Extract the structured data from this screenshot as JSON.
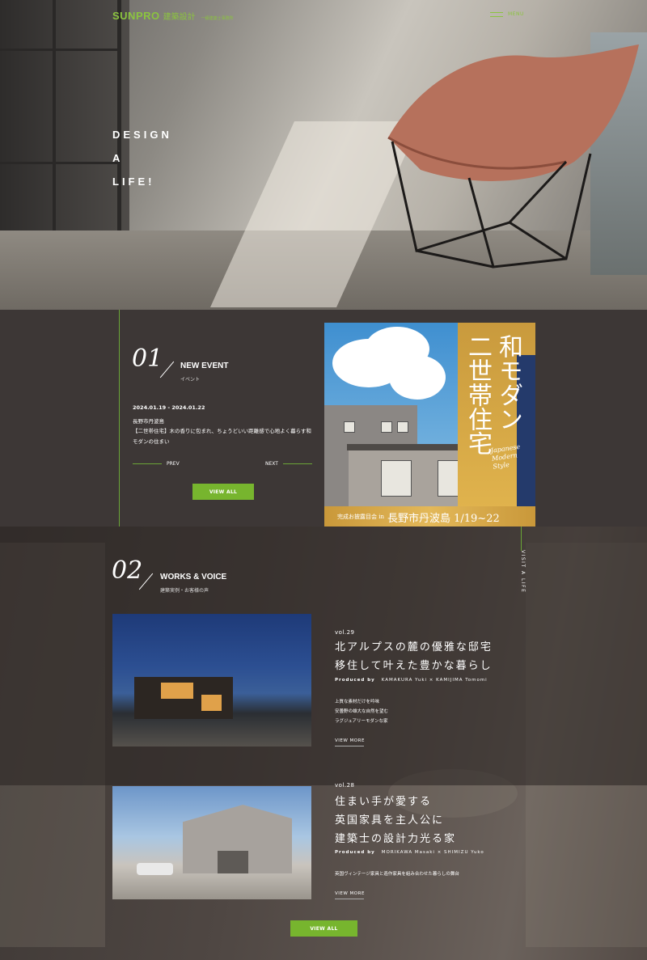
{
  "header": {
    "brand": "SUNPRO",
    "brand_sub": "建築設計",
    "brand_note": "一級建築士事務所",
    "menu_label": "MENU"
  },
  "hero": {
    "tagline_lines": [
      "DESIGN",
      "A",
      "LIFE!"
    ]
  },
  "event": {
    "number": "01",
    "title": "NEW EVENT",
    "subtitle": "イベント",
    "date": "2024.01.19 - 2024.01.22",
    "place": "長野市丹波島",
    "description": "【二世帯住宅】木の香りに包まれ、ちょうどいい距離感で心地よく暮らす和モダンの住まい",
    "prev_label": "PREV",
    "next_label": "NEXT",
    "view_all_label": "VIEW ALL",
    "poster": {
      "kanji_col1": "和モダン",
      "kanji_col2": "二世帯住宅",
      "english": "Japanese Modern Style",
      "banner_small": "完成お披露目会 in",
      "banner_big": "長野市丹波島 1/19~22"
    }
  },
  "works": {
    "number": "02",
    "title": "WORKS & VOICE",
    "subtitle": "建築実例・お客様の声",
    "side_label": "VISIT A LIFE",
    "items": [
      {
        "vol": "vol.29",
        "title_lines": [
          "北アルプスの麓の優雅な邸宅",
          "移住して叶えた豊かな暮らし"
        ],
        "produced_label": "Produced by",
        "produced_names": "KAMAKURA Yuki × KAMIJIMA Tomomi",
        "features": [
          "上質な素材だけを吟味",
          "安曇野の雄大な自然を望む",
          "ラグジュアリーモダンな家"
        ],
        "more_label": "VIEW MORE"
      },
      {
        "vol": "vol.28",
        "title_lines": [
          "住まい手が愛する",
          "英国家具を主人公に",
          "建築士の設計力光る家"
        ],
        "produced_label": "Produced by",
        "produced_names": "MORIKAWA Masaki × SHIMIZU Yuko",
        "features": [
          "英国ヴィンテージ家具と造作家具を組み合わせた暮らしの舞台"
        ],
        "more_label": "VIEW MORE"
      }
    ],
    "view_all_label": "VIEW ALL"
  },
  "colors": {
    "accent_green": "#77b52e",
    "logo_green": "#8bc43f",
    "dark_bg": "#3d3736"
  }
}
